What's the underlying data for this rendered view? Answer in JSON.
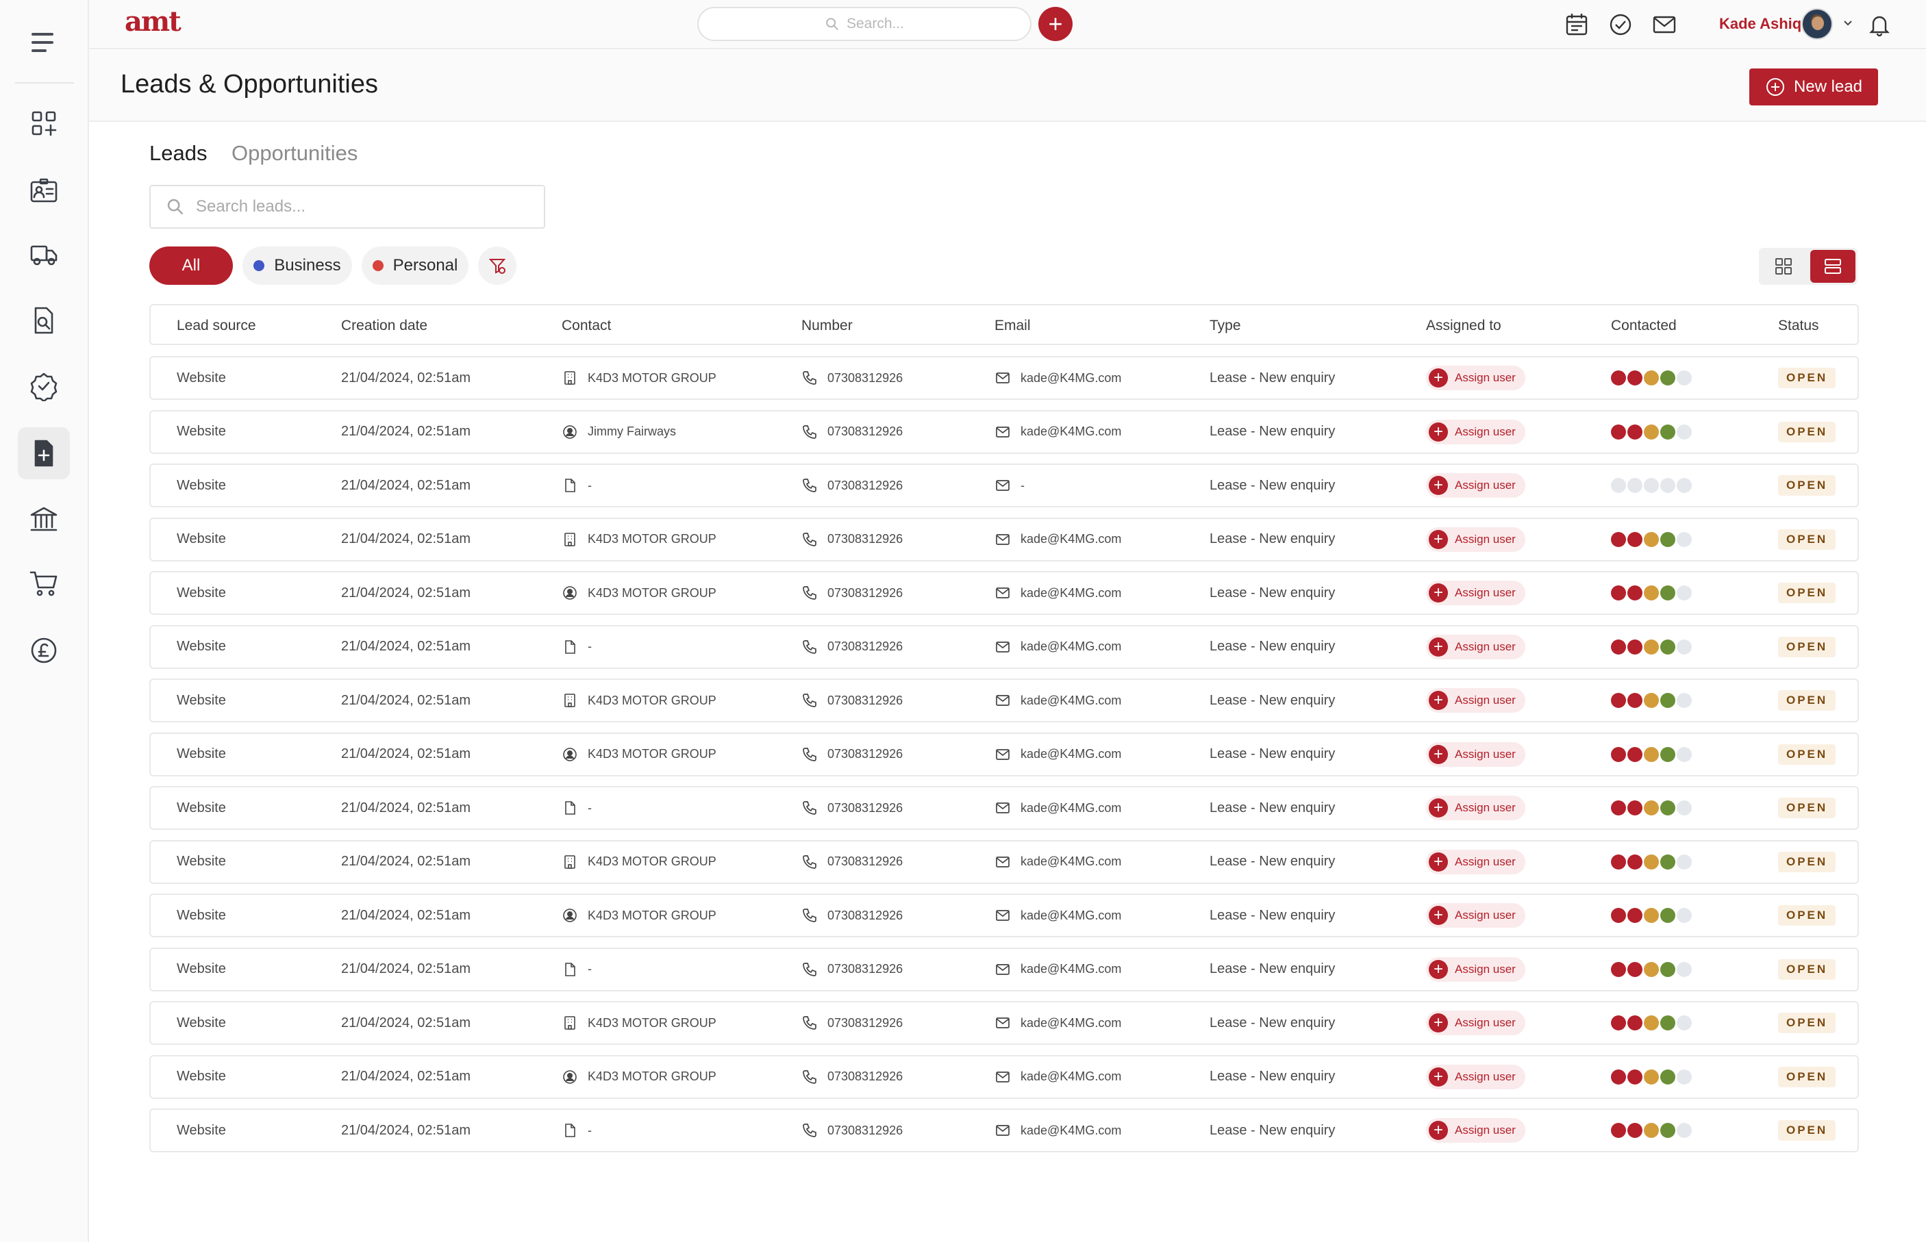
{
  "app": {
    "logo": "amt"
  },
  "topbar": {
    "search_placeholder": "Search...",
    "user_name": "Kade Ashiq",
    "icons": [
      "calendar-icon",
      "check-circle-icon",
      "mail-icon",
      "bell-icon"
    ]
  },
  "sidebar": {
    "items": [
      {
        "icon": "apps-add-icon",
        "active": false
      },
      {
        "icon": "contact-card-icon",
        "active": false
      },
      {
        "icon": "truck-icon",
        "active": false
      },
      {
        "icon": "document-search-icon",
        "active": false
      },
      {
        "icon": "badge-check-icon",
        "active": false
      },
      {
        "icon": "document-plus-icon",
        "active": true
      },
      {
        "icon": "bank-icon",
        "active": false
      },
      {
        "icon": "cart-icon",
        "active": false
      },
      {
        "icon": "pound-icon",
        "active": false
      }
    ]
  },
  "header": {
    "title": "Leads & Opportunities",
    "new_lead_label": "New lead"
  },
  "tabs": [
    {
      "label": "Leads",
      "active": true
    },
    {
      "label": "Opportunities",
      "active": false
    }
  ],
  "lead_search": {
    "placeholder": "Search leads..."
  },
  "filters": {
    "all": "All",
    "business": "Business",
    "personal": "Personal",
    "business_color": "#3f57c7",
    "personal_color": "#d9433b"
  },
  "colors": {
    "accent": "#b4202b",
    "contacted": [
      "#b4202b",
      "#b4202b",
      "#d39c3b",
      "#6a8f36",
      "#e4e7ec"
    ],
    "contacted_empty": "#e4e7ec"
  },
  "table": {
    "columns": [
      "Lead source",
      "Creation date",
      "Contact",
      "Number",
      "Email",
      "Type",
      "Assigned to",
      "Contacted",
      "Status"
    ],
    "rows": [
      {
        "source": "Website",
        "date": "21/04/2024, 02:51am",
        "contact_icon": "building-icon",
        "contact": "K4D3 MOTOR GROUP",
        "number": "07308312926",
        "email": "kade@K4MG.com",
        "type": "Lease - New enquiry",
        "assigned": "Assign user",
        "contacted": 4,
        "status": "OPEN"
      },
      {
        "source": "Website",
        "date": "21/04/2024, 02:51am",
        "contact_icon": "user-circle-icon",
        "contact": "Jimmy Fairways",
        "number": "07308312926",
        "email": "kade@K4MG.com",
        "type": "Lease - New enquiry",
        "assigned": "Assign user",
        "contacted": 4,
        "status": "OPEN"
      },
      {
        "source": "Website",
        "date": "21/04/2024, 02:51am",
        "contact_icon": "file-icon",
        "contact": "-",
        "number": "07308312926",
        "email": "-",
        "type": "Lease - New enquiry",
        "assigned": "Assign user",
        "contacted": 0,
        "status": "OPEN"
      },
      {
        "source": "Website",
        "date": "21/04/2024, 02:51am",
        "contact_icon": "building-icon",
        "contact": "K4D3 MOTOR GROUP",
        "number": "07308312926",
        "email": "kade@K4MG.com",
        "type": "Lease - New enquiry",
        "assigned": "Assign user",
        "contacted": 4,
        "status": "OPEN"
      },
      {
        "source": "Website",
        "date": "21/04/2024, 02:51am",
        "contact_icon": "user-circle-icon",
        "contact": "K4D3 MOTOR GROUP",
        "number": "07308312926",
        "email": "kade@K4MG.com",
        "type": "Lease - New enquiry",
        "assigned": "Assign user",
        "contacted": 4,
        "status": "OPEN"
      },
      {
        "source": "Website",
        "date": "21/04/2024, 02:51am",
        "contact_icon": "file-icon",
        "contact": "-",
        "number": "07308312926",
        "email": "kade@K4MG.com",
        "type": "Lease - New enquiry",
        "assigned": "Assign user",
        "contacted": 4,
        "status": "OPEN"
      },
      {
        "source": "Website",
        "date": "21/04/2024, 02:51am",
        "contact_icon": "building-icon",
        "contact": "K4D3 MOTOR GROUP",
        "number": "07308312926",
        "email": "kade@K4MG.com",
        "type": "Lease - New enquiry",
        "assigned": "Assign user",
        "contacted": 4,
        "status": "OPEN"
      },
      {
        "source": "Website",
        "date": "21/04/2024, 02:51am",
        "contact_icon": "user-circle-icon",
        "contact": "K4D3 MOTOR GROUP",
        "number": "07308312926",
        "email": "kade@K4MG.com",
        "type": "Lease - New enquiry",
        "assigned": "Assign user",
        "contacted": 4,
        "status": "OPEN"
      },
      {
        "source": "Website",
        "date": "21/04/2024, 02:51am",
        "contact_icon": "file-icon",
        "contact": "-",
        "number": "07308312926",
        "email": "kade@K4MG.com",
        "type": "Lease - New enquiry",
        "assigned": "Assign user",
        "contacted": 4,
        "status": "OPEN"
      },
      {
        "source": "Website",
        "date": "21/04/2024, 02:51am",
        "contact_icon": "building-icon",
        "contact": "K4D3 MOTOR GROUP",
        "number": "07308312926",
        "email": "kade@K4MG.com",
        "type": "Lease - New enquiry",
        "assigned": "Assign user",
        "contacted": 4,
        "status": "OPEN"
      },
      {
        "source": "Website",
        "date": "21/04/2024, 02:51am",
        "contact_icon": "user-circle-icon",
        "contact": "K4D3 MOTOR GROUP",
        "number": "07308312926",
        "email": "kade@K4MG.com",
        "type": "Lease - New enquiry",
        "assigned": "Assign user",
        "contacted": 4,
        "status": "OPEN"
      },
      {
        "source": "Website",
        "date": "21/04/2024, 02:51am",
        "contact_icon": "file-icon",
        "contact": "-",
        "number": "07308312926",
        "email": "kade@K4MG.com",
        "type": "Lease - New enquiry",
        "assigned": "Assign user",
        "contacted": 4,
        "status": "OPEN"
      },
      {
        "source": "Website",
        "date": "21/04/2024, 02:51am",
        "contact_icon": "building-icon",
        "contact": "K4D3 MOTOR GROUP",
        "number": "07308312926",
        "email": "kade@K4MG.com",
        "type": "Lease - New enquiry",
        "assigned": "Assign user",
        "contacted": 4,
        "status": "OPEN"
      },
      {
        "source": "Website",
        "date": "21/04/2024, 02:51am",
        "contact_icon": "user-circle-icon",
        "contact": "K4D3 MOTOR GROUP",
        "number": "07308312926",
        "email": "kade@K4MG.com",
        "type": "Lease - New enquiry",
        "assigned": "Assign user",
        "contacted": 4,
        "status": "OPEN"
      },
      {
        "source": "Website",
        "date": "21/04/2024, 02:51am",
        "contact_icon": "file-icon",
        "contact": "-",
        "number": "07308312926",
        "email": "kade@K4MG.com",
        "type": "Lease - New enquiry",
        "assigned": "Assign user",
        "contacted": 4,
        "status": "OPEN"
      }
    ]
  }
}
